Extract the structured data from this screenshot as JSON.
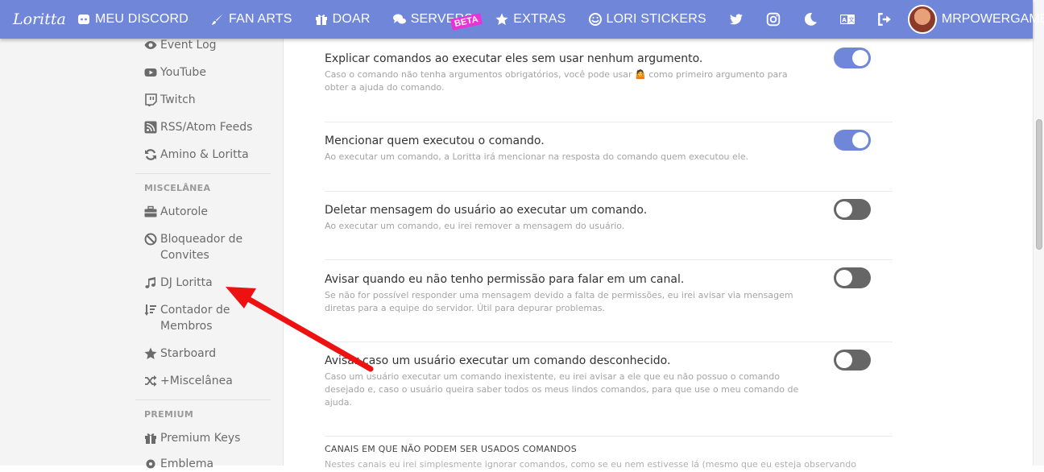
{
  "navbar": {
    "brand": "Loritta",
    "items": [
      {
        "label": "MEU DISCORD",
        "icon": "discord-icon"
      },
      {
        "label": "FAN ARTS",
        "icon": "brush-icon"
      },
      {
        "label": "DOAR",
        "icon": "gift-icon"
      },
      {
        "label": "SERVERS",
        "icon": "comments-icon",
        "badge": "BETA"
      },
      {
        "label": "EXTRAS",
        "icon": "star-icon"
      },
      {
        "label": "LORI STICKERS",
        "icon": "sticker-icon"
      }
    ],
    "username": "MRPOWERGAMERBR"
  },
  "sidebar": {
    "items_top": [
      {
        "label": "Event Log",
        "icon": "eye-icon"
      },
      {
        "label": "YouTube",
        "icon": "youtube-icon"
      },
      {
        "label": "Twitch",
        "icon": "twitch-icon"
      },
      {
        "label": "RSS/Atom Feeds",
        "icon": "rss-icon"
      },
      {
        "label": "Amino & Loritta",
        "icon": "sync-icon"
      }
    ],
    "misc_header": "MISCELÂNEA",
    "misc_items": [
      {
        "label": "Autorole",
        "icon": "briefcase-icon"
      },
      {
        "label": "Bloqueador de Convites",
        "icon": "ban-icon"
      },
      {
        "label": "DJ Loritta",
        "icon": "music-icon"
      },
      {
        "label": "Contador de Membros",
        "icon": "sort-icon"
      },
      {
        "label": "Starboard",
        "icon": "star-icon"
      },
      {
        "label": "+Miscelânea",
        "icon": "random-icon"
      }
    ],
    "premium_header": "PREMIUM",
    "premium_items": [
      {
        "label": "Premium Keys",
        "icon": "gift-icon"
      },
      {
        "label": "Emblema",
        "icon": "cog-icon"
      }
    ]
  },
  "settings": [
    {
      "title": "Explicar comandos ao executar eles sem usar nenhum argumento.",
      "desc": "Caso o comando não tenha argumentos obrigatórios, você pode usar 🤷 como primeiro argumento para obter a ajuda do comando.",
      "enabled": true
    },
    {
      "title": "Mencionar quem executou o comando.",
      "desc": "Ao executar um comando, a Loritta irá mencionar na resposta do comando quem executou ele.",
      "enabled": true
    },
    {
      "title": "Deletar mensagem do usuário ao executar um comando.",
      "desc": "Ao executar um comando, eu irei remover a mensagem do usuário.",
      "enabled": false
    },
    {
      "title": "Avisar quando eu não tenho permissão para falar em um canal.",
      "desc": "Se não for possível responder uma mensagem devido a falta de permissões, eu irei avisar via mensagem diretas para a equipe do servidor. Útil para depurar problemas.",
      "enabled": false
    },
    {
      "title": "Avisar caso um usuário executar um comando desconhecido.",
      "desc": "Caso um usuário executar um comando inexistente, eu irei avisar a ele que eu não possuo o comando desejado e, caso o usuário queira saber todos os meus lindos comandos, para que use o meu comando de ajuda.",
      "enabled": false
    }
  ],
  "channels_section": {
    "header": "CANAIS EM QUE NÃO PODEM SER USADOS COMANDOS",
    "desc": "Nestes canais eu irei simplesmente ignorar comandos, como se eu nem estivesse lá (mesmo que eu esteja observando"
  },
  "colors": {
    "accent": "#6f86d9",
    "annotation_arrow": "#ee1111"
  }
}
